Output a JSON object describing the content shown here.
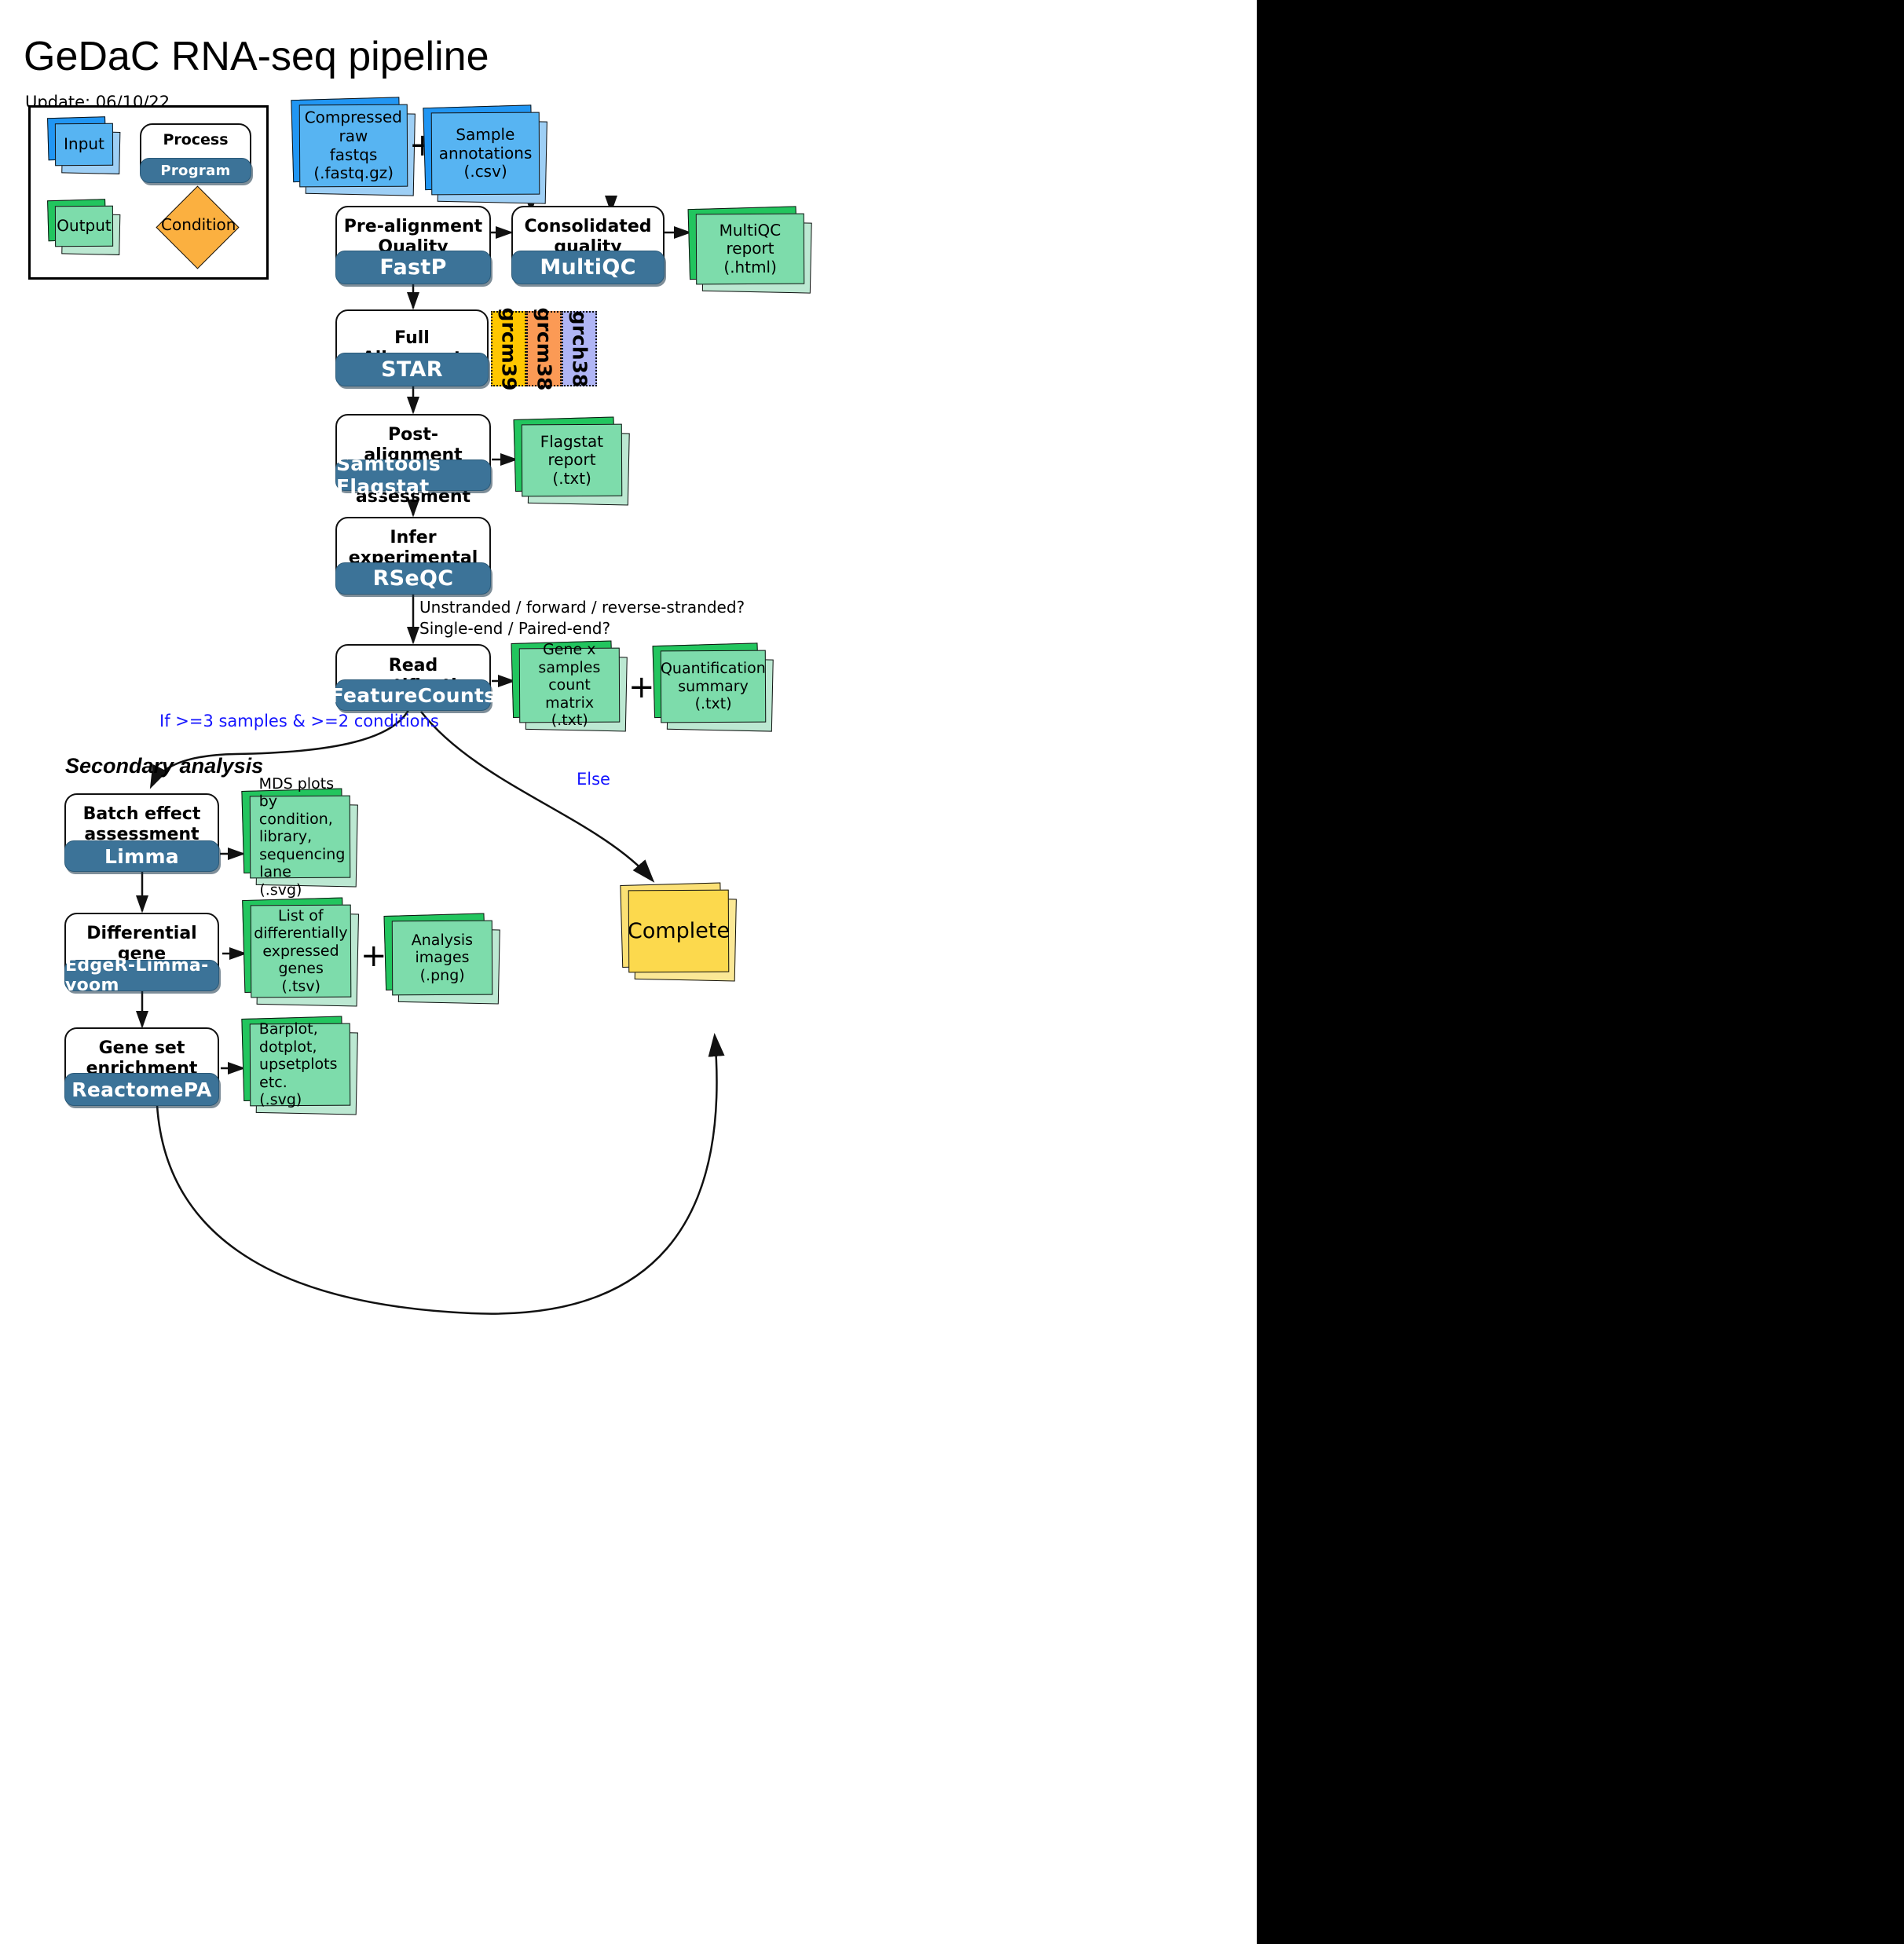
{
  "header": {
    "title": "GeDaC RNA-seq pipeline",
    "update_label": "Update: 06/10/22"
  },
  "legend": {
    "input_label": "Input",
    "process_label": "Process",
    "program_label": "Program",
    "output_label": "Output",
    "condition_label": "Condition"
  },
  "inputs": {
    "fastqs": "Compressed raw\nfastqs\n(.fastq.gz)",
    "fastqs_line1": "Compressed raw",
    "fastqs_line2": "fastqs",
    "fastqs_line3": "(.fastq.gz)",
    "plus": "+",
    "annotations_line1": "Sample",
    "annotations_line2": "annotations",
    "annotations_line3": "(.csv)"
  },
  "processes": {
    "prealign": {
      "title": "Pre-alignment\nQuality Control",
      "program": "FastP"
    },
    "multiqc": {
      "title": "Consolidated quality\nreport",
      "program": "MultiQC"
    },
    "align": {
      "title": "Full Alignment",
      "program": "STAR"
    },
    "postalign": {
      "title": "Post-alignment\nQuality assessment",
      "program": "Samtools Flagstat"
    },
    "infer": {
      "title": "Infer experimental\nproperties",
      "program": "RSeQC"
    },
    "quant": {
      "title": "Read quantification",
      "program": "FeatureCounts"
    },
    "batch": {
      "title": "Batch effect\nassessment",
      "program": "Limma"
    },
    "dge": {
      "title": "Differential gene\nexpression",
      "program": "EdgeR-Limma-voom"
    },
    "gsea": {
      "title": "Gene set\nenrichment analysis",
      "program": "ReactomePA"
    }
  },
  "genomes": [
    {
      "label": "grcm39",
      "color": "#FFC700"
    },
    {
      "label": "grcm38",
      "color": "#FB9A55"
    },
    {
      "label": "grch38",
      "color": "#B0B5F5"
    }
  ],
  "outputs": {
    "multiqc_report": "MultiQC report\n(.html)",
    "flagstat_report": "Flagstat report\n(.txt)",
    "count_matrix": "Gene x samples\ncount matrix\n(.txt)",
    "quant_summary": "Quantification\nsummary (.txt)",
    "mds_plots": "MDS plots by\ncondition, library,\nsequencing lane\n(.svg)",
    "deg_list": "List of\ndifferentially\nexpressed genes\n(.tsv)",
    "analysis_images": "Analysis images\n(.png)",
    "gsea_plots": "Barplot, dotplot,\nupsetplots etc.\n(.svg)",
    "plus1": "+",
    "plus2": "+"
  },
  "annotations": {
    "rseqc_question_line1": "Unstranded / forward / reverse-stranded?",
    "rseqc_question_line2": "Single-end / Paired-end?",
    "branch_if": "If >=3 samples & >=2 conditions",
    "branch_else": "Else",
    "secondary_analysis": "Secondary analysis"
  },
  "terminal": {
    "complete_label": "Complete"
  },
  "colors": {
    "input_blue": "#57B4F2",
    "output_green": "#7DDCAB",
    "program_navy": "#3C7398",
    "condition_orange": "#FBB040",
    "complete_yellow": "#FCD94D",
    "branch_text_blue": "#1414FF"
  }
}
